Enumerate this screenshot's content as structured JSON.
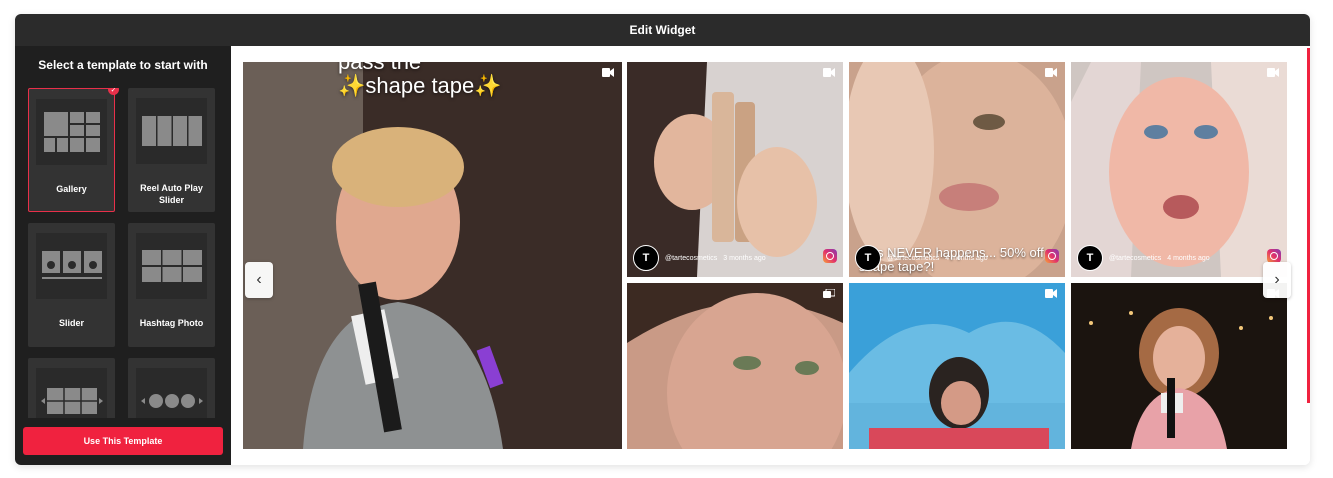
{
  "header": {
    "title": "Edit Widget"
  },
  "sidebar": {
    "title": "Select a template to start with",
    "templates": [
      {
        "label": "Gallery",
        "selected": true
      },
      {
        "label": "Reel Auto Play Slider",
        "selected": false
      },
      {
        "label": "Slider",
        "selected": false
      },
      {
        "label": "Hashtag Photo",
        "selected": false
      },
      {
        "label": "",
        "selected": false
      },
      {
        "label": "",
        "selected": false
      }
    ],
    "use_button": "Use This Template"
  },
  "gallery": {
    "featured_overlay": "pass the\n✨shape tape✨",
    "tiles": [
      {
        "avatar": "T",
        "handle": "@tartecosmetics",
        "age": "3 months ago",
        "caption": ""
      },
      {
        "avatar": "T",
        "handle": "@tartecosmetics",
        "age": "4 months ago",
        "caption": "This NEVER happens... 50% off shape tape?!"
      },
      {
        "avatar": "T",
        "handle": "@tartecosmetics",
        "age": "4 months ago",
        "caption": ""
      }
    ]
  },
  "colors": {
    "accent": "#f0223f",
    "dark": "#1f1f1f",
    "header": "#2b2b2b"
  }
}
